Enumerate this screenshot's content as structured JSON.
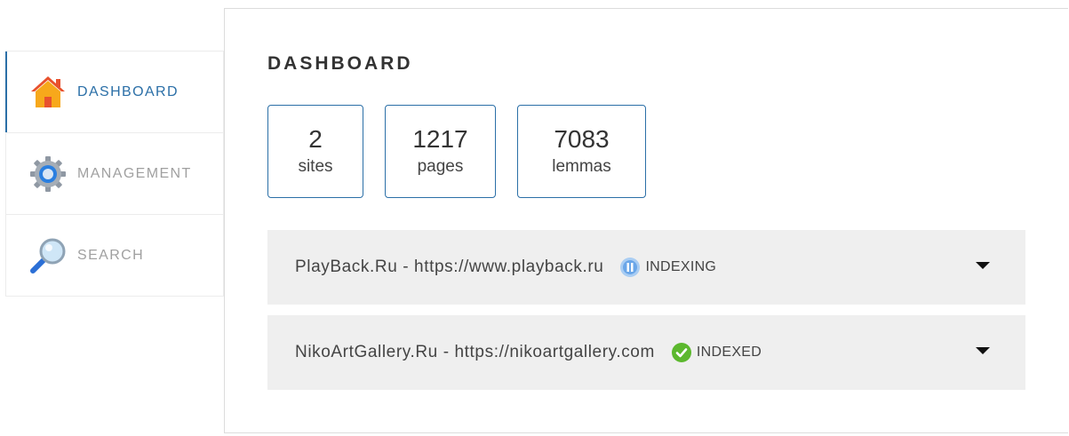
{
  "sidebar": {
    "items": [
      {
        "label": "DASHBOARD",
        "icon": "home-icon",
        "active": true
      },
      {
        "label": "MANAGEMENT",
        "icon": "gear-icon",
        "active": false
      },
      {
        "label": "SEARCH",
        "icon": "magnifier-icon",
        "active": false
      }
    ]
  },
  "main": {
    "title": "DASHBOARD",
    "stats": [
      {
        "value": "2",
        "label": "sites"
      },
      {
        "value": "1217",
        "label": "pages"
      },
      {
        "value": "7083",
        "label": "lemmas"
      }
    ],
    "sites": [
      {
        "name": "PlayBack.Ru - https://www.playback.ru",
        "status": "INDEXING",
        "status_icon": "pause-icon",
        "status_color": "#6aa6e8"
      },
      {
        "name": "NikoArtGallery.Ru - https://nikoartgallery.com",
        "status": "INDEXED",
        "status_icon": "check-icon",
        "status_color": "#5cb82e"
      }
    ]
  },
  "colors": {
    "accent": "#2b6fa7",
    "row_background": "#efefef",
    "inactive_text": "#a0a0a0"
  }
}
